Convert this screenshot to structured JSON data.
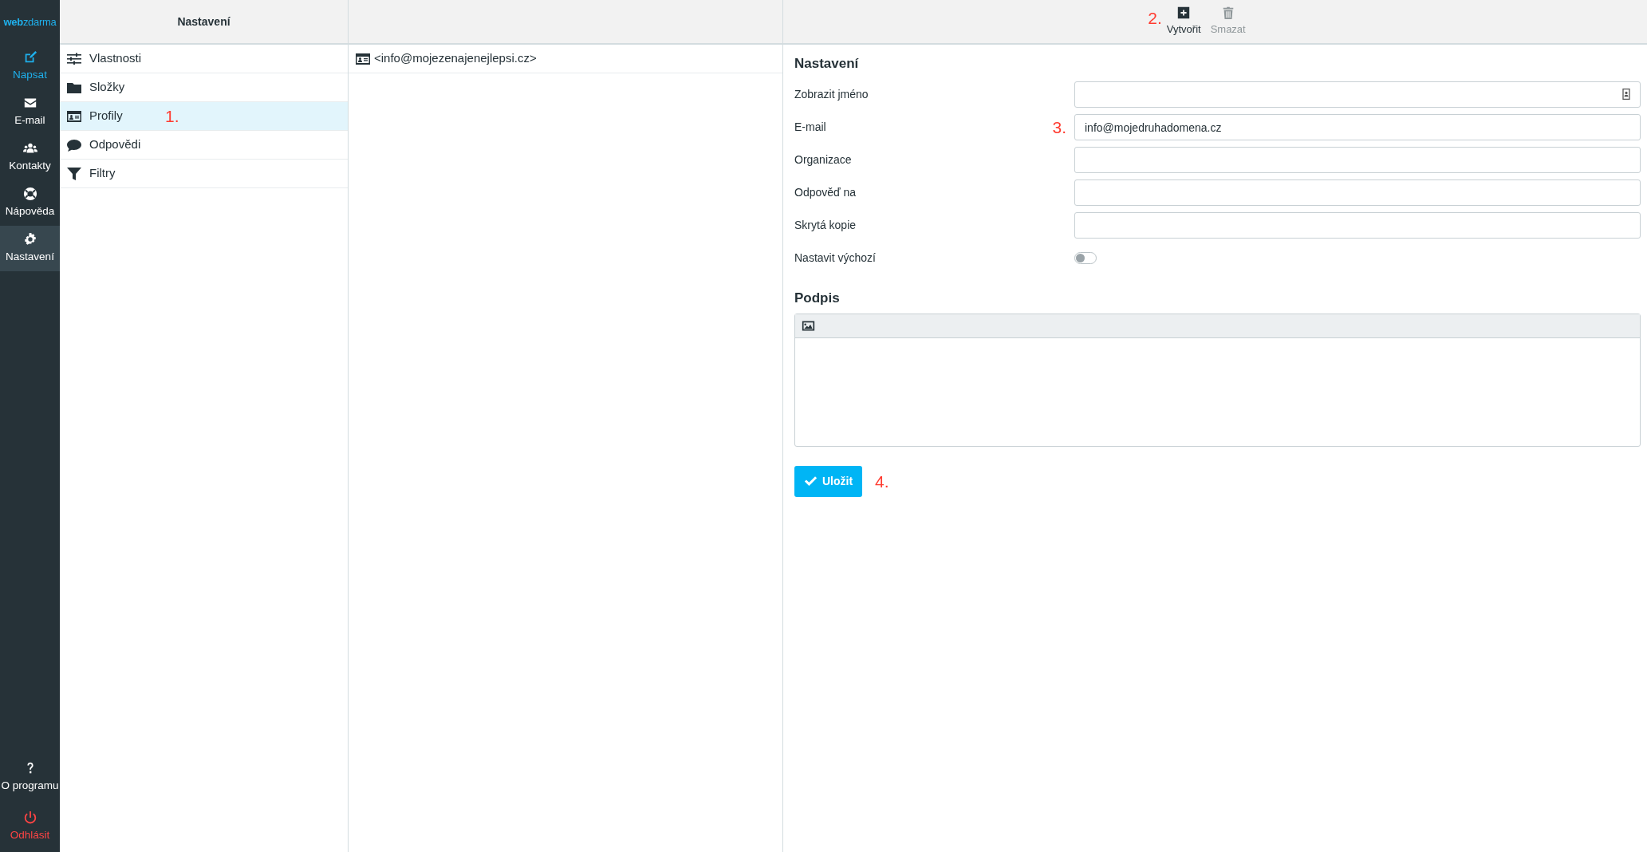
{
  "sidebar": {
    "logo": "**web**zdarma",
    "items": [
      {
        "label": "Napsat",
        "kind": "compose",
        "selected": false
      },
      {
        "label": "E-mail",
        "kind": "mail",
        "selected": false
      },
      {
        "label": "Kontakty",
        "kind": "contacts",
        "selected": false
      },
      {
        "label": "Nápověda",
        "kind": "help",
        "selected": false
      },
      {
        "label": "Nastavení",
        "kind": "settings",
        "selected": true
      }
    ],
    "bottom_items": [
      {
        "label": "O programu",
        "kind": "about"
      },
      {
        "label": "Odhlásit",
        "kind": "logout"
      }
    ]
  },
  "settings_panel": {
    "title": "Nastavení",
    "items": [
      {
        "label": "Vlastnosti",
        "kind": "sliders",
        "selected": false
      },
      {
        "label": "Složky",
        "kind": "folder",
        "selected": false
      },
      {
        "label": "Profily",
        "kind": "idcard",
        "selected": true,
        "annotation": "1."
      },
      {
        "label": "Odpovědi",
        "kind": "bubble",
        "selected": false
      },
      {
        "label": "Filtry",
        "kind": "filter",
        "selected": false
      }
    ]
  },
  "profiles_panel": {
    "items": [
      {
        "label": "<info@mojezenajenejlepsi.cz>"
      }
    ]
  },
  "toolbar": {
    "annotation": "2.",
    "buttons": [
      {
        "label": "Vytvořit",
        "kind": "create",
        "disabled": false
      },
      {
        "label": "Smazat",
        "kind": "delete",
        "disabled": true
      }
    ]
  },
  "form": {
    "title": "Nastavení",
    "fields": [
      {
        "label": "Zobrazit jméno",
        "kind": "text",
        "contact_icon": true
      },
      {
        "label": "E-mail",
        "kind": "text",
        "value": "info@mojedruhadomena.cz",
        "annotation": "3."
      },
      {
        "label": "Organizace",
        "kind": "text"
      },
      {
        "label": "Odpověď na",
        "kind": "text"
      },
      {
        "label": "Skrytá kopie",
        "kind": "text"
      },
      {
        "label": "Nastavit výchozí",
        "kind": "toggle",
        "on": false
      }
    ],
    "signature_title": "Podpis",
    "save_button": "Uložit",
    "save_annotation": "4."
  }
}
